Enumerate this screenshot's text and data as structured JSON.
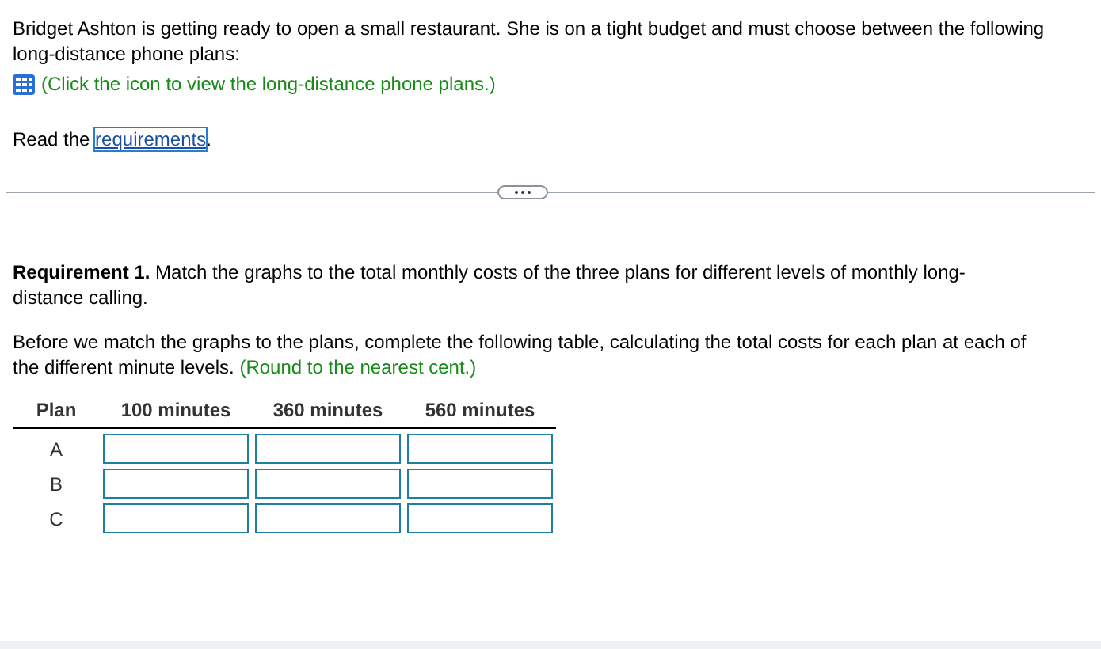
{
  "intro": "Bridget Ashton is getting ready to open a small restaurant. She is on a tight budget and must choose between the following long-distance phone plans:",
  "plans_link": "(Click the icon to view the long-distance phone plans.)",
  "read": {
    "before": "Read the ",
    "link": "requirements",
    "after": "."
  },
  "requirement": "**Requirement 1.** Match the graphs to the total monthly costs of the three plans for different levels of monthly long-distance calling.",
  "instruction": "Before we match the graphs to the plans, complete the following table, calculating the total costs for each plan at each of the different minute levels.",
  "hint": "(Round to the nearest cent.)",
  "table": {
    "columns": [
      "Plan",
      "100 minutes",
      "360 minutes",
      "560 minutes"
    ],
    "rows": [
      {
        "plan": "A"
      },
      {
        "plan": "B"
      },
      {
        "plan": "C"
      }
    ]
  }
}
